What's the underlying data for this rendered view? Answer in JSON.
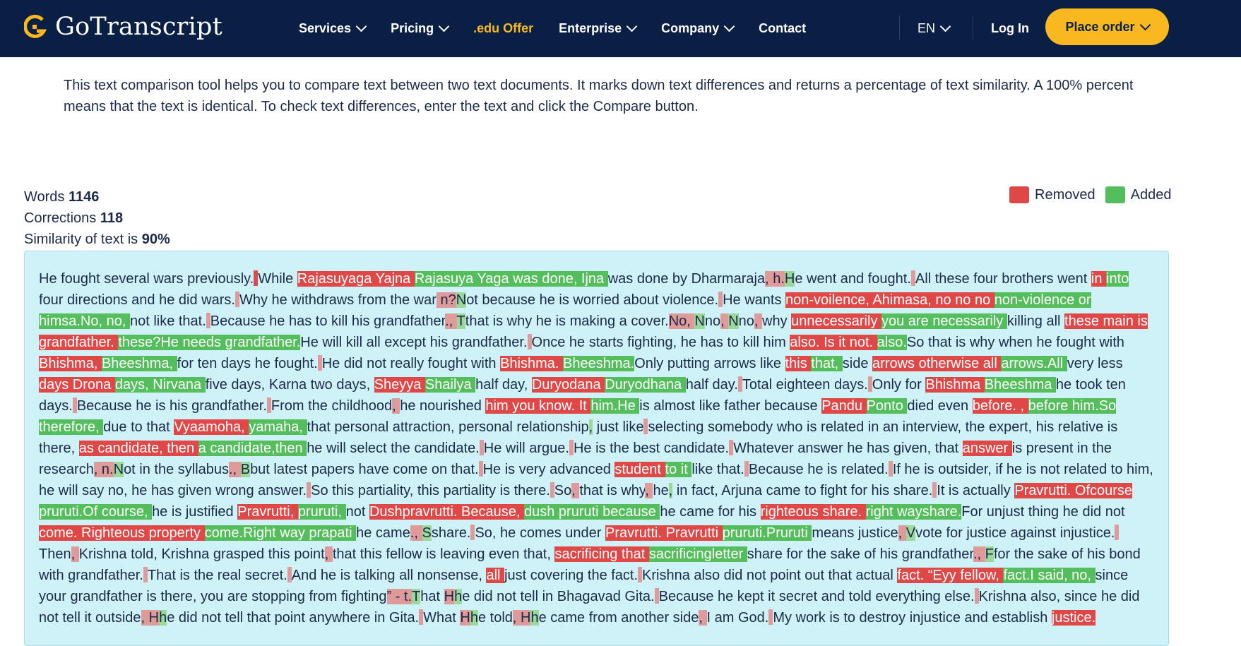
{
  "header": {
    "logo_text": "GoTranscript",
    "nav": [
      {
        "label": "Services",
        "dropdown": true
      },
      {
        "label": "Pricing",
        "dropdown": true
      },
      {
        "label": ".edu Offer",
        "dropdown": false
      },
      {
        "label": "Enterprise",
        "dropdown": true
      },
      {
        "label": "Company",
        "dropdown": true
      },
      {
        "label": "Contact",
        "dropdown": false
      }
    ],
    "language": "EN",
    "login": "Log In",
    "order_button": "Place order",
    "colors": {
      "bar": "#0a1f44",
      "accent": "#f9b820"
    }
  },
  "intro": "This text comparison tool helps you to compare text between two text documents. It marks down text differences and returns a percentage of text similarity. A 100% percent means that the text is identical. To check text differences, enter the text and click the Compare button.",
  "stats": {
    "words_label": "Words",
    "words_value": "1146",
    "corrections_label": "Corrections",
    "corrections_value": "118",
    "similarity_label": "Similarity of text is",
    "similarity_value": "90%"
  },
  "legend": {
    "removed": "Removed",
    "added": "Added",
    "removed_color": "#e04848",
    "added_color": "#53be5b"
  },
  "diff": [
    {
      "t": "He fought several wars previously."
    },
    {
      "m": "red"
    },
    {
      "t": "While "
    },
    {
      "r": "Rajasuyaga Yajna "
    },
    {
      "a": "Rajasuya Yaga was done, Ijna "
    },
    {
      "t": "was done by Dharmaraja"
    },
    {
      "rs": ", h."
    },
    {
      "as": "H"
    },
    {
      "t": "e went and fought."
    },
    {
      "m": "rs"
    },
    {
      "t": "All these four brothers went "
    },
    {
      "r": "in "
    },
    {
      "a": "into "
    },
    {
      "t": "four directions and he did wars."
    },
    {
      "m": "rs"
    },
    {
      "t": "Why he withdraws from the war"
    },
    {
      "rs": " n?"
    },
    {
      "as": "N"
    },
    {
      "t": "ot because he is worried about violence."
    },
    {
      "m": "rs"
    },
    {
      "t": "He wants "
    },
    {
      "r": "non-voilence, Ahimasa, no no no "
    },
    {
      "a": "non-violence or himsa.No, no, "
    },
    {
      "t": "not like that."
    },
    {
      "m": "rs"
    },
    {
      "t": "Because he has to kill his grandfather"
    },
    {
      "rs": "., "
    },
    {
      "as": "T"
    },
    {
      "t": "that is why he is making a cover."
    },
    {
      "rs": "No, "
    },
    {
      "as": "N"
    },
    {
      "t": "no"
    },
    {
      "rs": ", "
    },
    {
      "as": "N"
    },
    {
      "t": "no"
    },
    {
      "rs": ", "
    },
    {
      "t": "why "
    },
    {
      "r": "unnecessarily "
    },
    {
      "a": "you are necessarily "
    },
    {
      "t": "killing all "
    },
    {
      "r": "these main is grandfather. "
    },
    {
      "a": "these?He needs grandfather."
    },
    {
      "t": "He will kill all except his grandfather."
    },
    {
      "m": "rs"
    },
    {
      "t": "Once he starts fighting, he has to kill him "
    },
    {
      "r": "also. Is it not. "
    },
    {
      "a": "also."
    },
    {
      "t": "So that is why when he fought with "
    },
    {
      "r": "Bhishma, "
    },
    {
      "a": "Bheeshma, "
    },
    {
      "t": "for ten days he fought."
    },
    {
      "m": "rs"
    },
    {
      "t": "He did not really fought with "
    },
    {
      "r": "Bhishma. "
    },
    {
      "a": "Bheeshma."
    },
    {
      "t": "Only putting arrows like "
    },
    {
      "r": "this "
    },
    {
      "a": "that, "
    },
    {
      "t": "side "
    },
    {
      "r": "arrows otherwise all "
    },
    {
      "a": "arrows.All "
    },
    {
      "t": "very less "
    },
    {
      "r": "days Drona "
    },
    {
      "a": "days, Nirvana "
    },
    {
      "t": "five days, Karna two days, "
    },
    {
      "r": "Sheyya "
    },
    {
      "a": "Shailya "
    },
    {
      "t": "half day, "
    },
    {
      "r": "Duryodana "
    },
    {
      "a": "Duryodhana "
    },
    {
      "t": "half day."
    },
    {
      "m": "rs"
    },
    {
      "t": "Total eighteen days."
    },
    {
      "m": "rs"
    },
    {
      "t": "Only for "
    },
    {
      "r": "Bhishma "
    },
    {
      "a": "Bheeshma "
    },
    {
      "t": "he took ten days."
    },
    {
      "m": "rs"
    },
    {
      "t": "Because he is his grandfather."
    },
    {
      "m": "rs"
    },
    {
      "t": "From the childhood"
    },
    {
      "rs": ", "
    },
    {
      "t": "he nourished "
    },
    {
      "r": "him you know. It "
    },
    {
      "a": "him.He "
    },
    {
      "t": "is almost like father because "
    },
    {
      "r": "Pandu "
    },
    {
      "a": "Ponto "
    },
    {
      "t": "died even "
    },
    {
      "r": "before. , "
    },
    {
      "a": "before him.So therefore, "
    },
    {
      "t": "due to that "
    },
    {
      "r": "Vyaamoha, "
    },
    {
      "a": "yamaha, "
    },
    {
      "t": "that personal attraction, personal relationship"
    },
    {
      "as": ","
    },
    {
      "t": " just like"
    },
    {
      "m": "rs"
    },
    {
      "t": "selecting somebody who is related in an interview, the expert, his relative is there, "
    },
    {
      "r": "as candidate, then "
    },
    {
      "a": "a candidate,then "
    },
    {
      "t": "he will select the candidate."
    },
    {
      "m": "rs"
    },
    {
      "t": "He will argue."
    },
    {
      "m": "rs"
    },
    {
      "t": "He is the best candidate."
    },
    {
      "m": "rs"
    },
    {
      "t": "Whatever answer he has given, that "
    },
    {
      "r": "answer "
    },
    {
      "t": "is present in the research"
    },
    {
      "rs": ", n."
    },
    {
      "as": "N"
    },
    {
      "t": "ot in the syllabus"
    },
    {
      "rs": "., "
    },
    {
      "as": "B"
    },
    {
      "t": "but latest papers have come on that."
    },
    {
      "m": "rs"
    },
    {
      "t": "He is very advanced "
    },
    {
      "r": "student "
    },
    {
      "a": "to it "
    },
    {
      "t": "like that."
    },
    {
      "m": "rs"
    },
    {
      "t": "Because he is related."
    },
    {
      "m": "rs"
    },
    {
      "t": "If he is outsider, if he is not related to him, he will say no, he has given wrong answer."
    },
    {
      "m": "rs"
    },
    {
      "t": "So this partiality, this partiality is there."
    },
    {
      "m": "rs"
    },
    {
      "t": "So"
    },
    {
      "rs": ", "
    },
    {
      "t": "that is why"
    },
    {
      "rs": ", "
    },
    {
      "t": "he"
    },
    {
      "as": ","
    },
    {
      "t": " in fact, Arjuna came to fight for his share."
    },
    {
      "m": "rs"
    },
    {
      "t": "It is actually "
    },
    {
      "r": "Pravrutti. Ofcourse "
    },
    {
      "a": "pruruti.Of course, "
    },
    {
      "t": "he is justified "
    },
    {
      "r": "Pravrutti, "
    },
    {
      "a": "pruruti, "
    },
    {
      "t": "not "
    },
    {
      "r": "Dushpravrutti. Because, "
    },
    {
      "a": "dush pruruti because "
    },
    {
      "t": "he came for his "
    },
    {
      "r": "righteous share. "
    },
    {
      "a": "right wayshare."
    },
    {
      "t": "For unjust thing he did not "
    },
    {
      "r": "come. Righteous property "
    },
    {
      "a": "come.Right way prapati "
    },
    {
      "t": "he came"
    },
    {
      "rs": "., "
    },
    {
      "as": "S"
    },
    {
      "t": "share."
    },
    {
      "m": "rs"
    },
    {
      "t": "So, he comes under "
    },
    {
      "r": "Pravrutti. Pravrutti "
    },
    {
      "a": "pruruti.Pruruti "
    },
    {
      "t": "means justice"
    },
    {
      "rs": ", "
    },
    {
      "as": "V"
    },
    {
      "t": "vote for justice against injustice."
    },
    {
      "m": "rs"
    },
    {
      "t": "Then"
    },
    {
      "rs": ", "
    },
    {
      "t": "Krishna told, Krishna grasped this point"
    },
    {
      "rs": ", "
    },
    {
      "t": "that this fellow is leaving even that, "
    },
    {
      "r": "sacrificing that "
    },
    {
      "a": "sacrificingletter "
    },
    {
      "t": "share for the sake of his grandfather"
    },
    {
      "rs": "., "
    },
    {
      "as": "F"
    },
    {
      "t": "for the sake of his bond with grandfather."
    },
    {
      "m": "rs"
    },
    {
      "t": "That is the real secret."
    },
    {
      "m": "rs"
    },
    {
      "t": "And he is talking all nonsense, "
    },
    {
      "r": "all "
    },
    {
      "t": "just covering the fact."
    },
    {
      "m": "rs"
    },
    {
      "t": "Krishna also did not point out that actual "
    },
    {
      "r": "fact. “Eyy fellow, "
    },
    {
      "a": "fact.I said, no, "
    },
    {
      "t": "since your grandfather is there, you are stopping from fighting"
    },
    {
      "rs": "” - t."
    },
    {
      "as": "T"
    },
    {
      "t": "hat "
    },
    {
      "rs": "H"
    },
    {
      "as": "h"
    },
    {
      "t": "e did not tell in Bhagavad Gita."
    },
    {
      "m": "rs"
    },
    {
      "t": "Because he kept it secret and told everything else."
    },
    {
      "m": "rs"
    },
    {
      "t": "Krishna also, since he did not tell it outside"
    },
    {
      "rs": ", "
    },
    {
      "rs": "H"
    },
    {
      "as": "h"
    },
    {
      "t": "e did not tell that point anywhere in Gita."
    },
    {
      "m": "rs"
    },
    {
      "t": "What "
    },
    {
      "rs": "H"
    },
    {
      "as": "h"
    },
    {
      "t": "e told"
    },
    {
      "rs": ", "
    },
    {
      "rs": "H"
    },
    {
      "as": "h"
    },
    {
      "t": "e came from another side"
    },
    {
      "rs": ", "
    },
    {
      "t": "I am God."
    },
    {
      "m": "rs"
    },
    {
      "t": "My work is to destroy injustice and establish "
    },
    {
      "r": "justice."
    }
  ]
}
